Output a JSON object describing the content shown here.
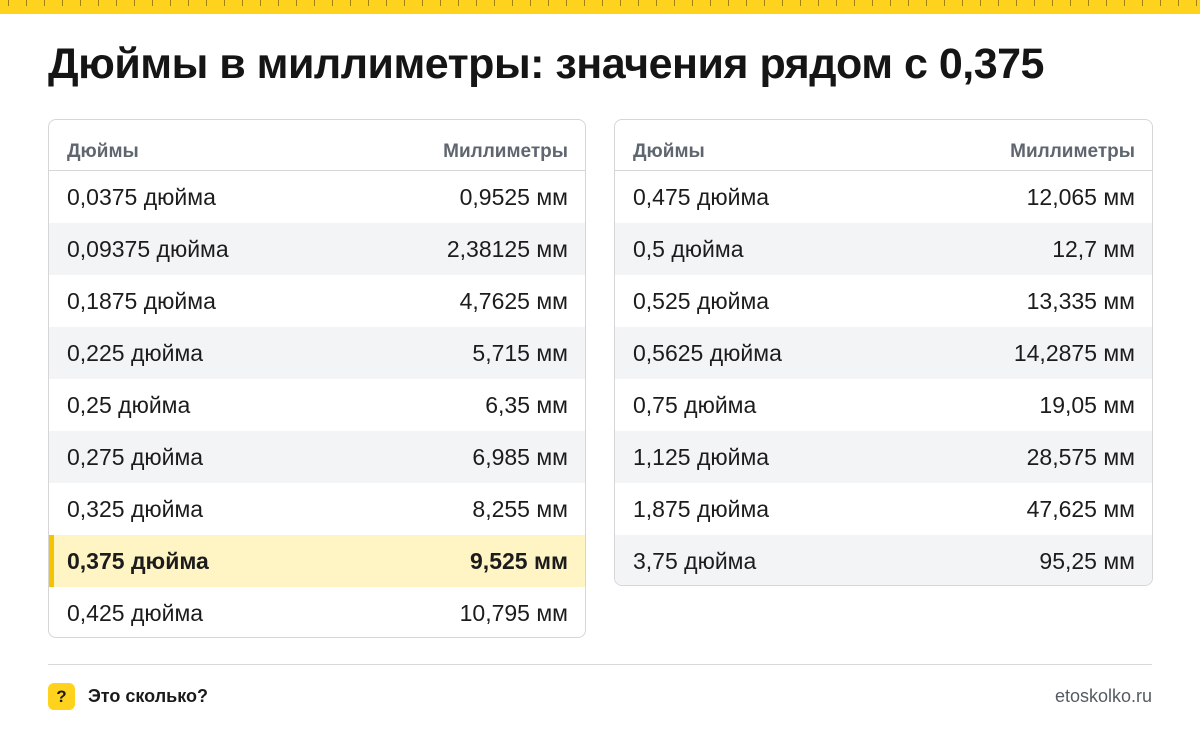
{
  "title": "Дюймы в миллиметры: значения рядом с 0,375",
  "colors": {
    "accent": "#ffd21e",
    "highlight_bg": "#fff4c4",
    "highlight_bar": "#f5c400",
    "alt_row": "#f3f4f6"
  },
  "left_table": {
    "headers": {
      "inches": "Дюймы",
      "mm": "Миллиметры"
    },
    "rows": [
      {
        "inches": "0,0375 дюйма",
        "mm": "0,9525 мм"
      },
      {
        "inches": "0,09375 дюйма",
        "mm": "2,38125 мм"
      },
      {
        "inches": "0,1875 дюйма",
        "mm": "4,7625 мм"
      },
      {
        "inches": "0,225 дюйма",
        "mm": "5,715 мм"
      },
      {
        "inches": "0,25 дюйма",
        "mm": "6,35 мм"
      },
      {
        "inches": "0,275 дюйма",
        "mm": "6,985 мм"
      },
      {
        "inches": "0,325 дюйма",
        "mm": "8,255 мм"
      },
      {
        "inches": "0,375 дюйма",
        "mm": "9,525 мм",
        "highlighted": true
      },
      {
        "inches": "0,425 дюйма",
        "mm": "10,795 мм"
      }
    ]
  },
  "right_table": {
    "headers": {
      "inches": "Дюймы",
      "mm": "Миллиметры"
    },
    "rows": [
      {
        "inches": "0,475 дюйма",
        "mm": "12,065 мм"
      },
      {
        "inches": "0,5 дюйма",
        "mm": "12,7 мм"
      },
      {
        "inches": "0,525 дюйма",
        "mm": "13,335 мм"
      },
      {
        "inches": "0,5625 дюйма",
        "mm": "14,2875 мм"
      },
      {
        "inches": "0,75 дюйма",
        "mm": "19,05 мм"
      },
      {
        "inches": "1,125 дюйма",
        "mm": "28,575 мм"
      },
      {
        "inches": "1,875 дюйма",
        "mm": "47,625 мм"
      },
      {
        "inches": "3,75 дюйма",
        "mm": "95,25 мм"
      }
    ]
  },
  "footer": {
    "brand_icon": "?",
    "brand_icon_name": "question-mark-icon",
    "brand_name": "Это сколько?",
    "site": "etoskolko.ru"
  }
}
